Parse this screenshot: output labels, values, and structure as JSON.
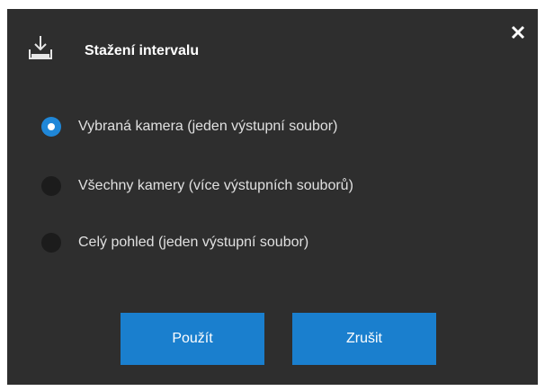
{
  "dialog": {
    "title": "Stažení intervalu",
    "header_icon": "download-icon",
    "close_icon": "close-icon"
  },
  "options": [
    {
      "label": "Vybraná kamera (jeden výstupní soubor)",
      "selected": true
    },
    {
      "label": "Všechny kamery (více výstupních souborů)",
      "selected": false
    },
    {
      "label": "Celý pohled (jeden výstupní soubor)",
      "selected": false
    }
  ],
  "buttons": {
    "apply_label": "Použít",
    "cancel_label": "Zrušit"
  },
  "colors": {
    "dialog_background": "#2e2e2e",
    "accent": "#1a7fce",
    "radio_unselected": "#1c1c1c"
  }
}
